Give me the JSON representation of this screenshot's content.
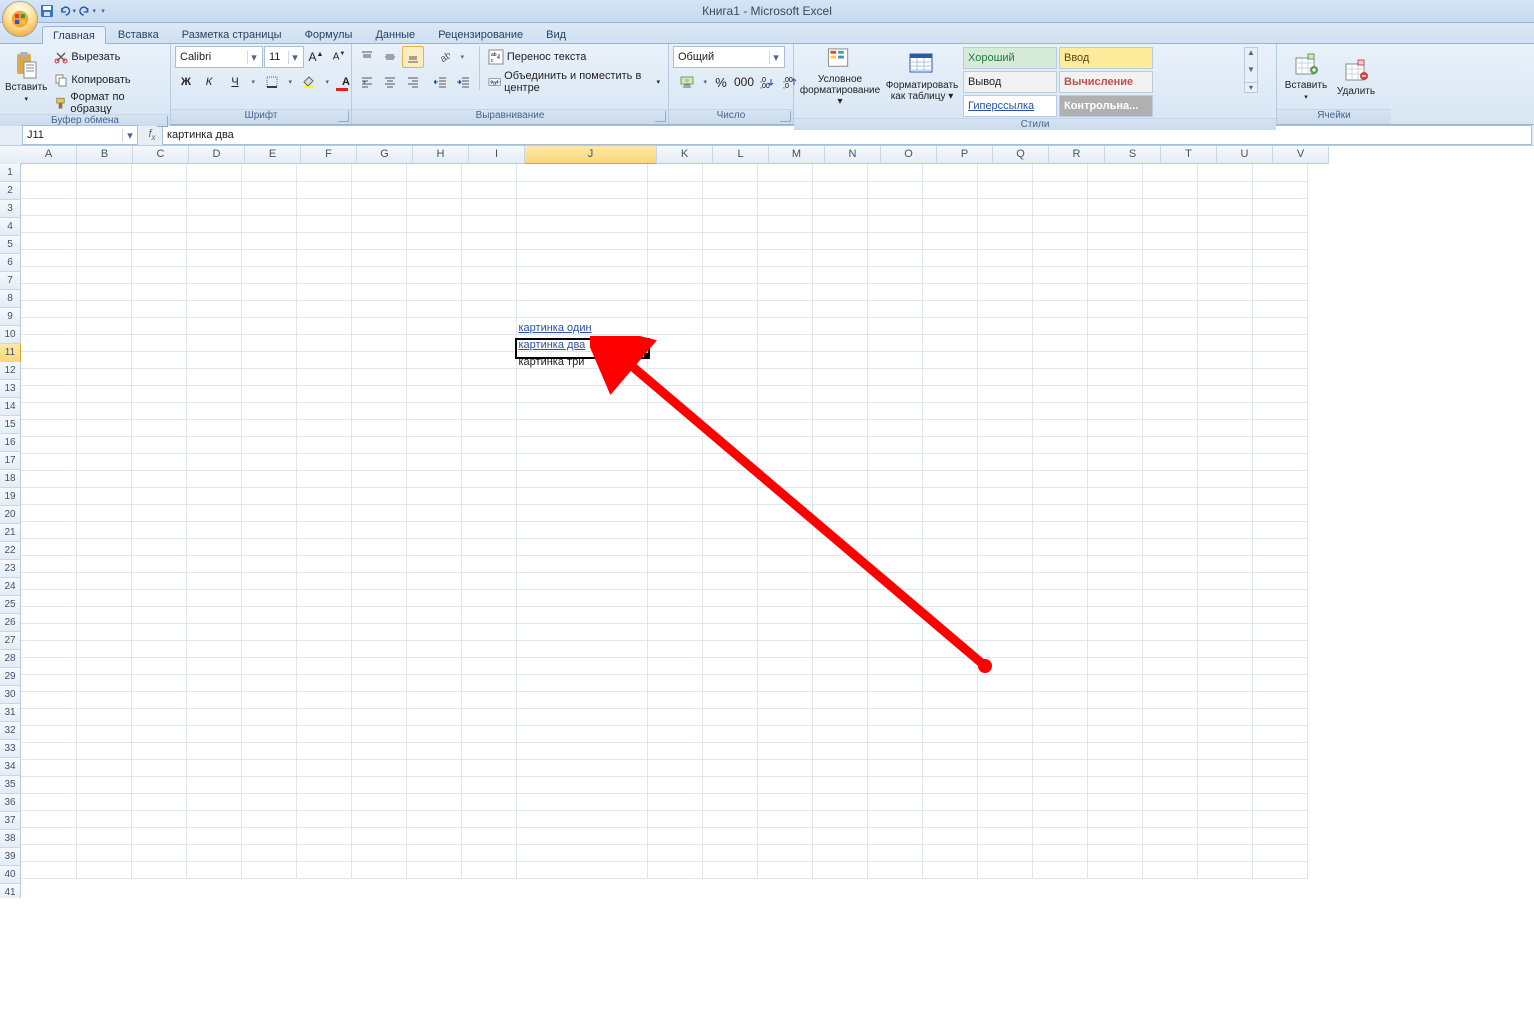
{
  "app": {
    "title": "Книга1 - Microsoft Excel"
  },
  "tabs": {
    "items": [
      "Главная",
      "Вставка",
      "Разметка страницы",
      "Формулы",
      "Данные",
      "Рецензирование",
      "Вид"
    ],
    "active": 0
  },
  "clipboard": {
    "paste": "Вставить",
    "cut": "Вырезать",
    "copy": "Копировать",
    "format_painter": "Формат по образцу",
    "group": "Буфер обмена"
  },
  "font": {
    "name": "Calibri",
    "size": "11",
    "bold": "Ж",
    "italic": "К",
    "underline": "Ч",
    "group": "Шрифт"
  },
  "align": {
    "wrap": "Перенос текста",
    "merge": "Объединить и поместить в центре",
    "group": "Выравнивание"
  },
  "number": {
    "format": "Общий",
    "group": "Число"
  },
  "styles": {
    "cond": "Условное форматирование",
    "table": "Форматировать как таблицу",
    "good": "Хороший",
    "input": "Ввод",
    "output": "Вывод",
    "calc": "Вычисление",
    "link": "Гиперссылка",
    "check": "Контрольна...",
    "group": "Стили"
  },
  "cellsgrp": {
    "insert": "Вставить",
    "delete": "Удалить",
    "group": "Ячейки"
  },
  "namebox": {
    "ref": "J11"
  },
  "formula": {
    "value": "картинка два"
  },
  "columns": [
    "A",
    "B",
    "C",
    "D",
    "E",
    "F",
    "G",
    "H",
    "I",
    "J",
    "K",
    "L",
    "M",
    "N",
    "O",
    "P",
    "Q",
    "R",
    "S",
    "T",
    "U",
    "V"
  ],
  "wide_col": "J",
  "sel_col": "J",
  "sel_row": 11,
  "cells": {
    "J10": {
      "text": "картинка один",
      "link": true
    },
    "J11": {
      "text": "картинка два",
      "link": true
    },
    "J12": {
      "text": "картинка три",
      "link": false
    }
  },
  "row_count": 42
}
